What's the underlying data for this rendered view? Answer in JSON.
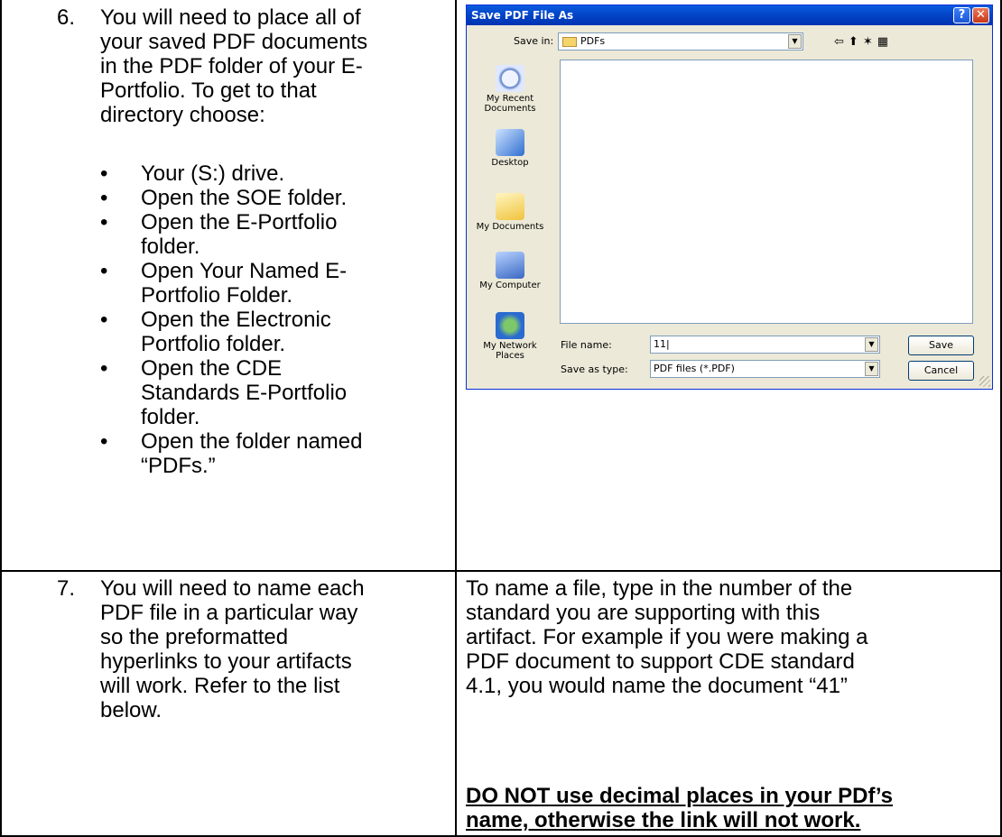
{
  "step6": {
    "number": "6.",
    "text_lines": [
      "You will need to place all of",
      "your saved PDF documents",
      "in the PDF folder of your E-",
      "Portfolio.  To get to that",
      "directory choose:"
    ],
    "bullets": [
      [
        "Your (S:) drive."
      ],
      [
        "Open the SOE folder."
      ],
      [
        "Open the E-Portfolio",
        "folder."
      ],
      [
        "Open Your Named E-",
        "Portfolio Folder."
      ],
      [
        "Open the Electronic",
        "Portfolio folder."
      ],
      [
        "Open the CDE",
        "Standards E-Portfolio",
        "folder."
      ],
      [
        "Open the folder named",
        "“PDFs.”"
      ]
    ]
  },
  "dialog": {
    "title": "Save PDF File As",
    "help_glyph": "?",
    "close_glyph": "✕",
    "save_in_label": "Save in:",
    "save_in_value": "PDFs",
    "places": [
      "My Recent Documents",
      "Desktop",
      "My Documents",
      "My Computer",
      "My Network Places"
    ],
    "file_name_label": "File name:",
    "file_name_value": "11",
    "save_type_label": "Save as type:",
    "save_type_value": "PDF files (*.PDF)",
    "save_button": "Save",
    "cancel_button": "Cancel"
  },
  "step7": {
    "number": "7.",
    "text_lines": [
      "You will need to name each",
      "PDF file in a particular way",
      "so the preformatted",
      "hyperlinks to your artifacts",
      "will work.  Refer to the list",
      "below."
    ],
    "right_lines": [
      "To name a file, type in the number of the",
      "standard you are supporting with this",
      "artifact.  For example if you were making a",
      "PDF document to support CDE standard",
      "4.1, you would name the document  “41”"
    ],
    "warning_lead": "DO NOT",
    "warning_rest_line1": " use decimal places in your PDf’s",
    "warning_line2": "name, otherwise the link will not work."
  },
  "icons": [
    "back-arrow-icon",
    "up-folder-icon",
    "new-folder-icon",
    "views-menu-icon",
    "dropdown-arrow-icon",
    "folder-icon",
    "resize-grip-icon"
  ]
}
